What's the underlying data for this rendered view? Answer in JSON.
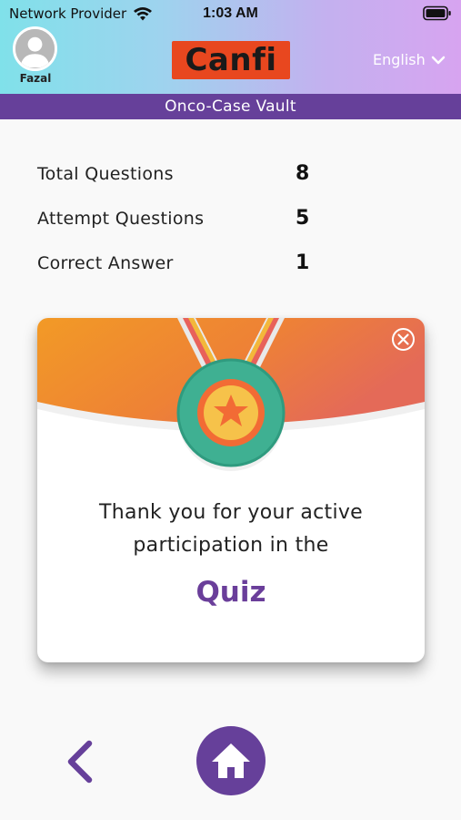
{
  "status_bar": {
    "carrier": "Network Provider",
    "time": "1:03 AM"
  },
  "header": {
    "user_name": "Fazal",
    "logo_text": "Canfi",
    "language": "English",
    "section_title": "Onco-Case Vault"
  },
  "stats": [
    {
      "label": "Total Questions",
      "value": "8"
    },
    {
      "label": "Attempt Questions",
      "value": "5"
    },
    {
      "label": "Correct Answer",
      "value": "1"
    }
  ],
  "result_card": {
    "message_line1": "Thank you for your active",
    "message_line2": "participation in the",
    "highlight": "Quiz"
  },
  "colors": {
    "brand_purple": "#66409a",
    "logo_orange": "#e8471f",
    "banner_orange": "#f0902a"
  },
  "icons": [
    "wifi-icon",
    "battery-icon",
    "avatar",
    "chevron-down-icon",
    "close-icon",
    "medal-icon",
    "back-icon",
    "home-icon"
  ]
}
